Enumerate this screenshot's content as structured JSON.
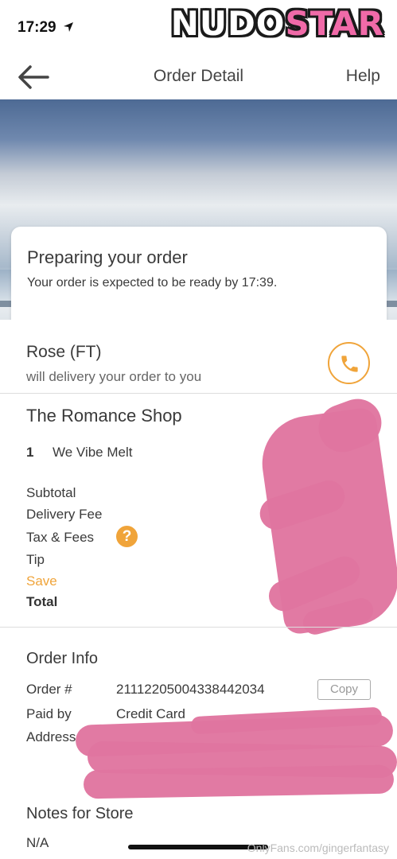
{
  "status_bar": {
    "time": "17:29"
  },
  "watermark": {
    "part1": "NUDO",
    "part2": "STAR",
    "footer": "OnlyFans.com/gingerfantasy"
  },
  "nav": {
    "title": "Order Detail",
    "help": "Help"
  },
  "status_card": {
    "title": "Preparing your order",
    "subtitle": "Your order is expected to be ready by 17:39."
  },
  "courier": {
    "name": "Rose (FT)",
    "subtitle": "will delivery your order to you"
  },
  "shop": {
    "name": "The Romance Shop",
    "items": [
      {
        "qty": "1",
        "name": "We Vibe Melt"
      }
    ],
    "fees": {
      "subtotal": "Subtotal",
      "delivery_fee": "Delivery Fee",
      "tax_fees": "Tax & Fees",
      "tip": "Tip",
      "save": "Save",
      "total": "Total"
    }
  },
  "order_info": {
    "title": "Order Info",
    "order_label": "Order #",
    "order_number": "21112205004338442034",
    "copy": "Copy",
    "paid_label": "Paid by",
    "paid_value": "Credit Card",
    "address_label": "Address"
  },
  "notes": {
    "title": "Notes for Store",
    "value": "N/A"
  },
  "colors": {
    "accent": "#f0a43a",
    "redaction": "#e0759f"
  }
}
